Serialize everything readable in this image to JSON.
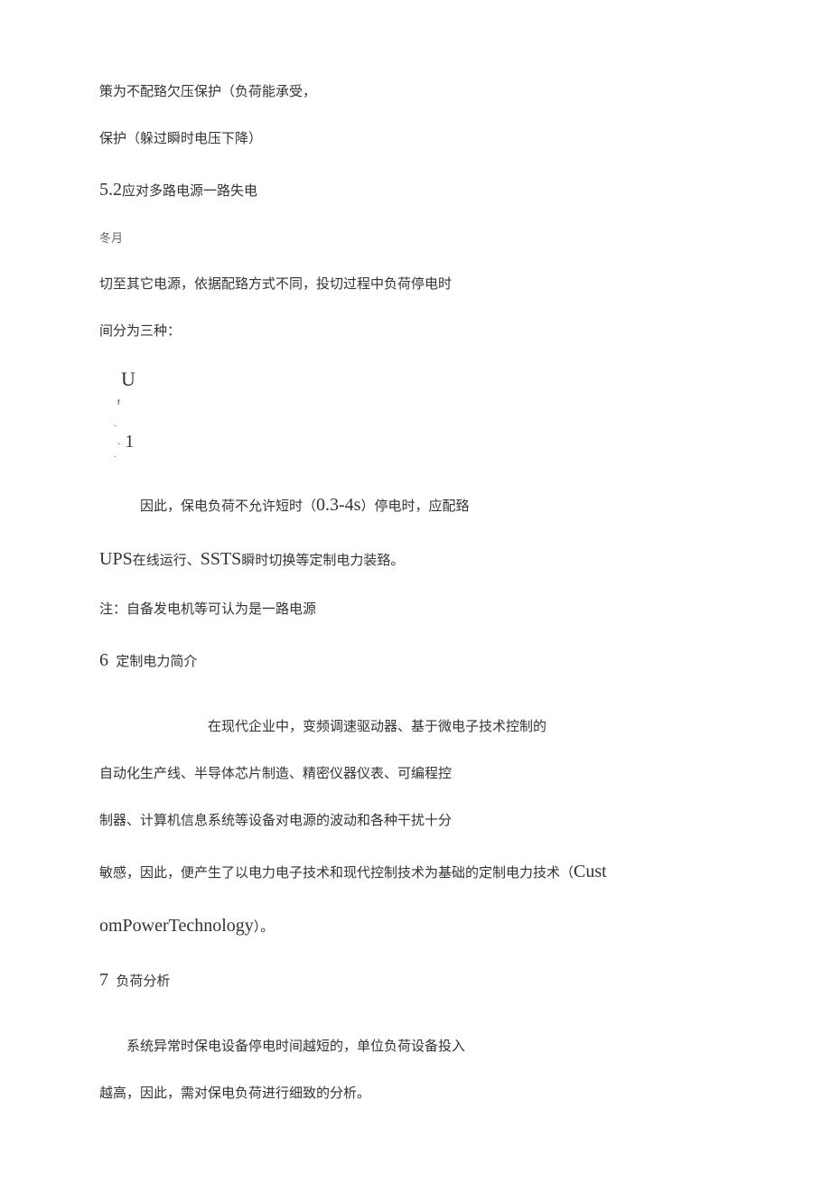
{
  "p1": "策为不配臵欠压保护（负荷能承受，",
  "p2": "保护（躲过瞬时电压下降）",
  "h52_num": "5.2",
  "h52_text": "应对多路电源一路失电",
  "frag1": "冬月",
  "p3": "切至其它电源，依据配臵方式不同，投切过程中负荷停电时",
  "p4": "间分为三种：",
  "u_letter": "U",
  "r_mark": "r",
  "dot": "·",
  "one": "1",
  "p5_prefix": "因此，保电负荷不允许短时（",
  "p5_range": "0.3-4s",
  "p5_suffix": "）停电时，应配臵",
  "p6_ups": "UPS",
  "p6_mid1": "在线运行、",
  "p6_ssts": "SSTS",
  "p6_suffix": "瞬时切换等定制电力装臵。",
  "p7": "注：自备发电机等可认为是一路电源",
  "h6_num": "6",
  "h6_text": "定制电力简介",
  "p8": "在现代企业中，变频调速驱动器、基于微电子技术控制的",
  "p9": "自动化生产线、半导体芯片制造、精密仪器仪表、可编程控",
  "p10": "制器、计算机信息系统等设备对电源的波动和各种干扰十分",
  "p11_prefix": "敏感，因此，便产生了以电力电子技术和现代控制技术为基础的定制电力技术（",
  "p11_cust": "Cust",
  "p12_om": "omPowerTechnology",
  "p12_suffix": "）。",
  "h7_num": "7",
  "h7_text": "负荷分析",
  "p13": "系统异常时保电设备停电时间越短的，单位负荷设备投入",
  "p14": "越高，因此，需对保电负荷进行细致的分析。"
}
